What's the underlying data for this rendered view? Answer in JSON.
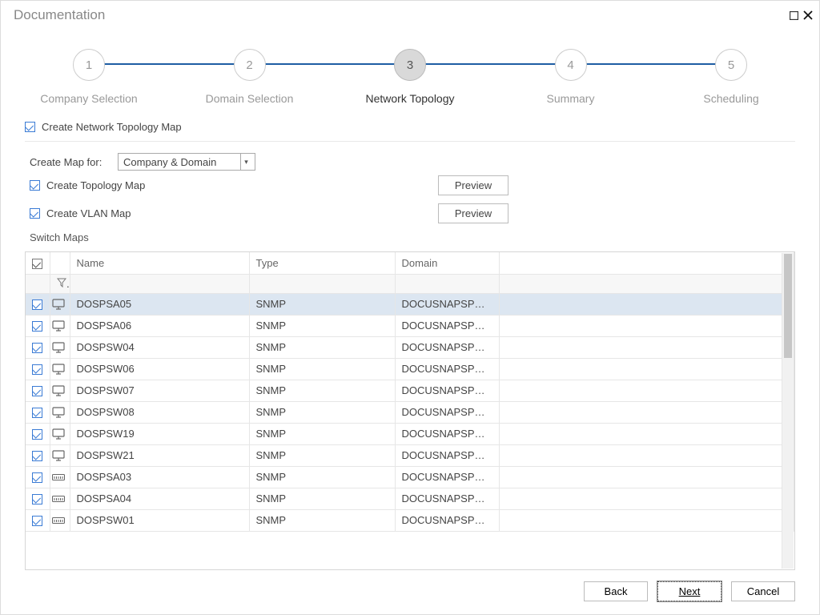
{
  "window": {
    "title": "Documentation"
  },
  "stepper": {
    "steps": [
      {
        "num": "1",
        "label": "Company Selection",
        "active": false
      },
      {
        "num": "2",
        "label": "Domain Selection",
        "active": false
      },
      {
        "num": "3",
        "label": "Network Topology",
        "active": true
      },
      {
        "num": "4",
        "label": "Summary",
        "active": false
      },
      {
        "num": "5",
        "label": "Scheduling",
        "active": false
      }
    ]
  },
  "options": {
    "create_map_checkbox_label": "Create Network Topology Map",
    "create_map_for_label": "Create Map for:",
    "create_map_for_value": "Company & Domain",
    "create_topology_label": "Create Topology Map",
    "create_vlan_label": "Create VLAN Map",
    "preview_button": "Preview",
    "switch_maps_label": "Switch Maps"
  },
  "grid": {
    "headers": {
      "name": "Name",
      "type": "Type",
      "domain": "Domain"
    },
    "rows": [
      {
        "name": "DOSPSA05",
        "type": "SNMP",
        "domain": "DOCUSNAPSPOR...",
        "icon": "monitor",
        "selected": true
      },
      {
        "name": "DOSPSA06",
        "type": "SNMP",
        "domain": "DOCUSNAPSPOR...",
        "icon": "monitor"
      },
      {
        "name": "DOSPSW04",
        "type": "SNMP",
        "domain": "DOCUSNAPSPOR...",
        "icon": "monitor"
      },
      {
        "name": "DOSPSW06",
        "type": "SNMP",
        "domain": "DOCUSNAPSPOR...",
        "icon": "monitor"
      },
      {
        "name": "DOSPSW07",
        "type": "SNMP",
        "domain": "DOCUSNAPSPOR...",
        "icon": "monitor"
      },
      {
        "name": "DOSPSW08",
        "type": "SNMP",
        "domain": "DOCUSNAPSPOR...",
        "icon": "monitor"
      },
      {
        "name": "DOSPSW19",
        "type": "SNMP",
        "domain": "DOCUSNAPSPOR...",
        "icon": "monitor"
      },
      {
        "name": "DOSPSW21",
        "type": "SNMP",
        "domain": "DOCUSNAPSPOR...",
        "icon": "monitor"
      },
      {
        "name": "DOSPSA03",
        "type": "SNMP",
        "domain": "DOCUSNAPSPOR...",
        "icon": "switch"
      },
      {
        "name": "DOSPSA04",
        "type": "SNMP",
        "domain": "DOCUSNAPSPOR...",
        "icon": "switch"
      },
      {
        "name": "DOSPSW01",
        "type": "SNMP",
        "domain": "DOCUSNAPSPOR...",
        "icon": "switch"
      }
    ]
  },
  "footer": {
    "back": "Back",
    "next": "Next",
    "cancel": "Cancel"
  }
}
